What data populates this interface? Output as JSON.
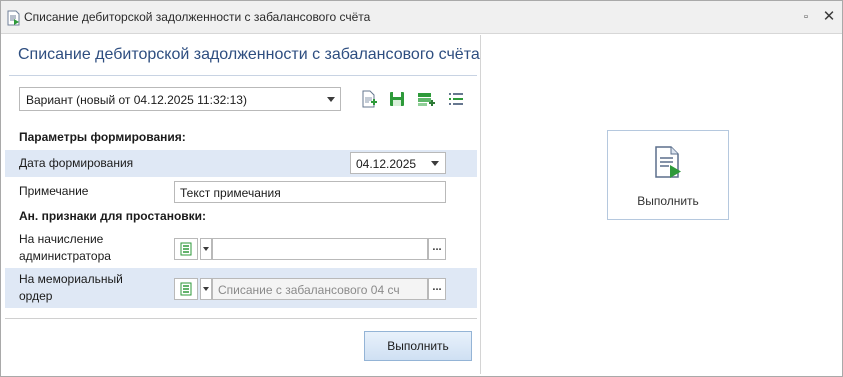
{
  "window": {
    "title": "Списание дебиторской задолженности с забалансового счёта",
    "title_icon": "document-go-icon",
    "controls": {
      "restore": "▫",
      "close": "✕"
    }
  },
  "form": {
    "title": "Списание дебиторской задолженности с забалансового счёта",
    "variant": {
      "value": "Вариант (новый от 04.12.2025 11:32:13)"
    },
    "toolbar_icons": [
      "new-document-icon",
      "save-icon",
      "add-record-icon",
      "list-settings-icon"
    ],
    "params_header": "Параметры формирования:",
    "date_label": "Дата формирования",
    "date_value": "04.12.2025",
    "note_label": "Примечание",
    "note_value": "Текст примечания",
    "attrs_header": "Ан. признаки для простановки:",
    "accrual_label_line1": "На начисление",
    "accrual_label_line2": "администратора",
    "accrual_value": "",
    "memorial_label_line1": "На мемориальный",
    "memorial_label_line2": "ордер",
    "memorial_value": "Списание с забалансового 04 сч",
    "ellipsis": "...",
    "run_label": "Выполнить"
  },
  "side": {
    "run_label": "Выполнить",
    "run_icon": "run-document-icon"
  },
  "colors": {
    "title_blue": "#2e4e80",
    "highlight_row": "#dfe8f5",
    "icon_green": "#2e9a3a"
  }
}
